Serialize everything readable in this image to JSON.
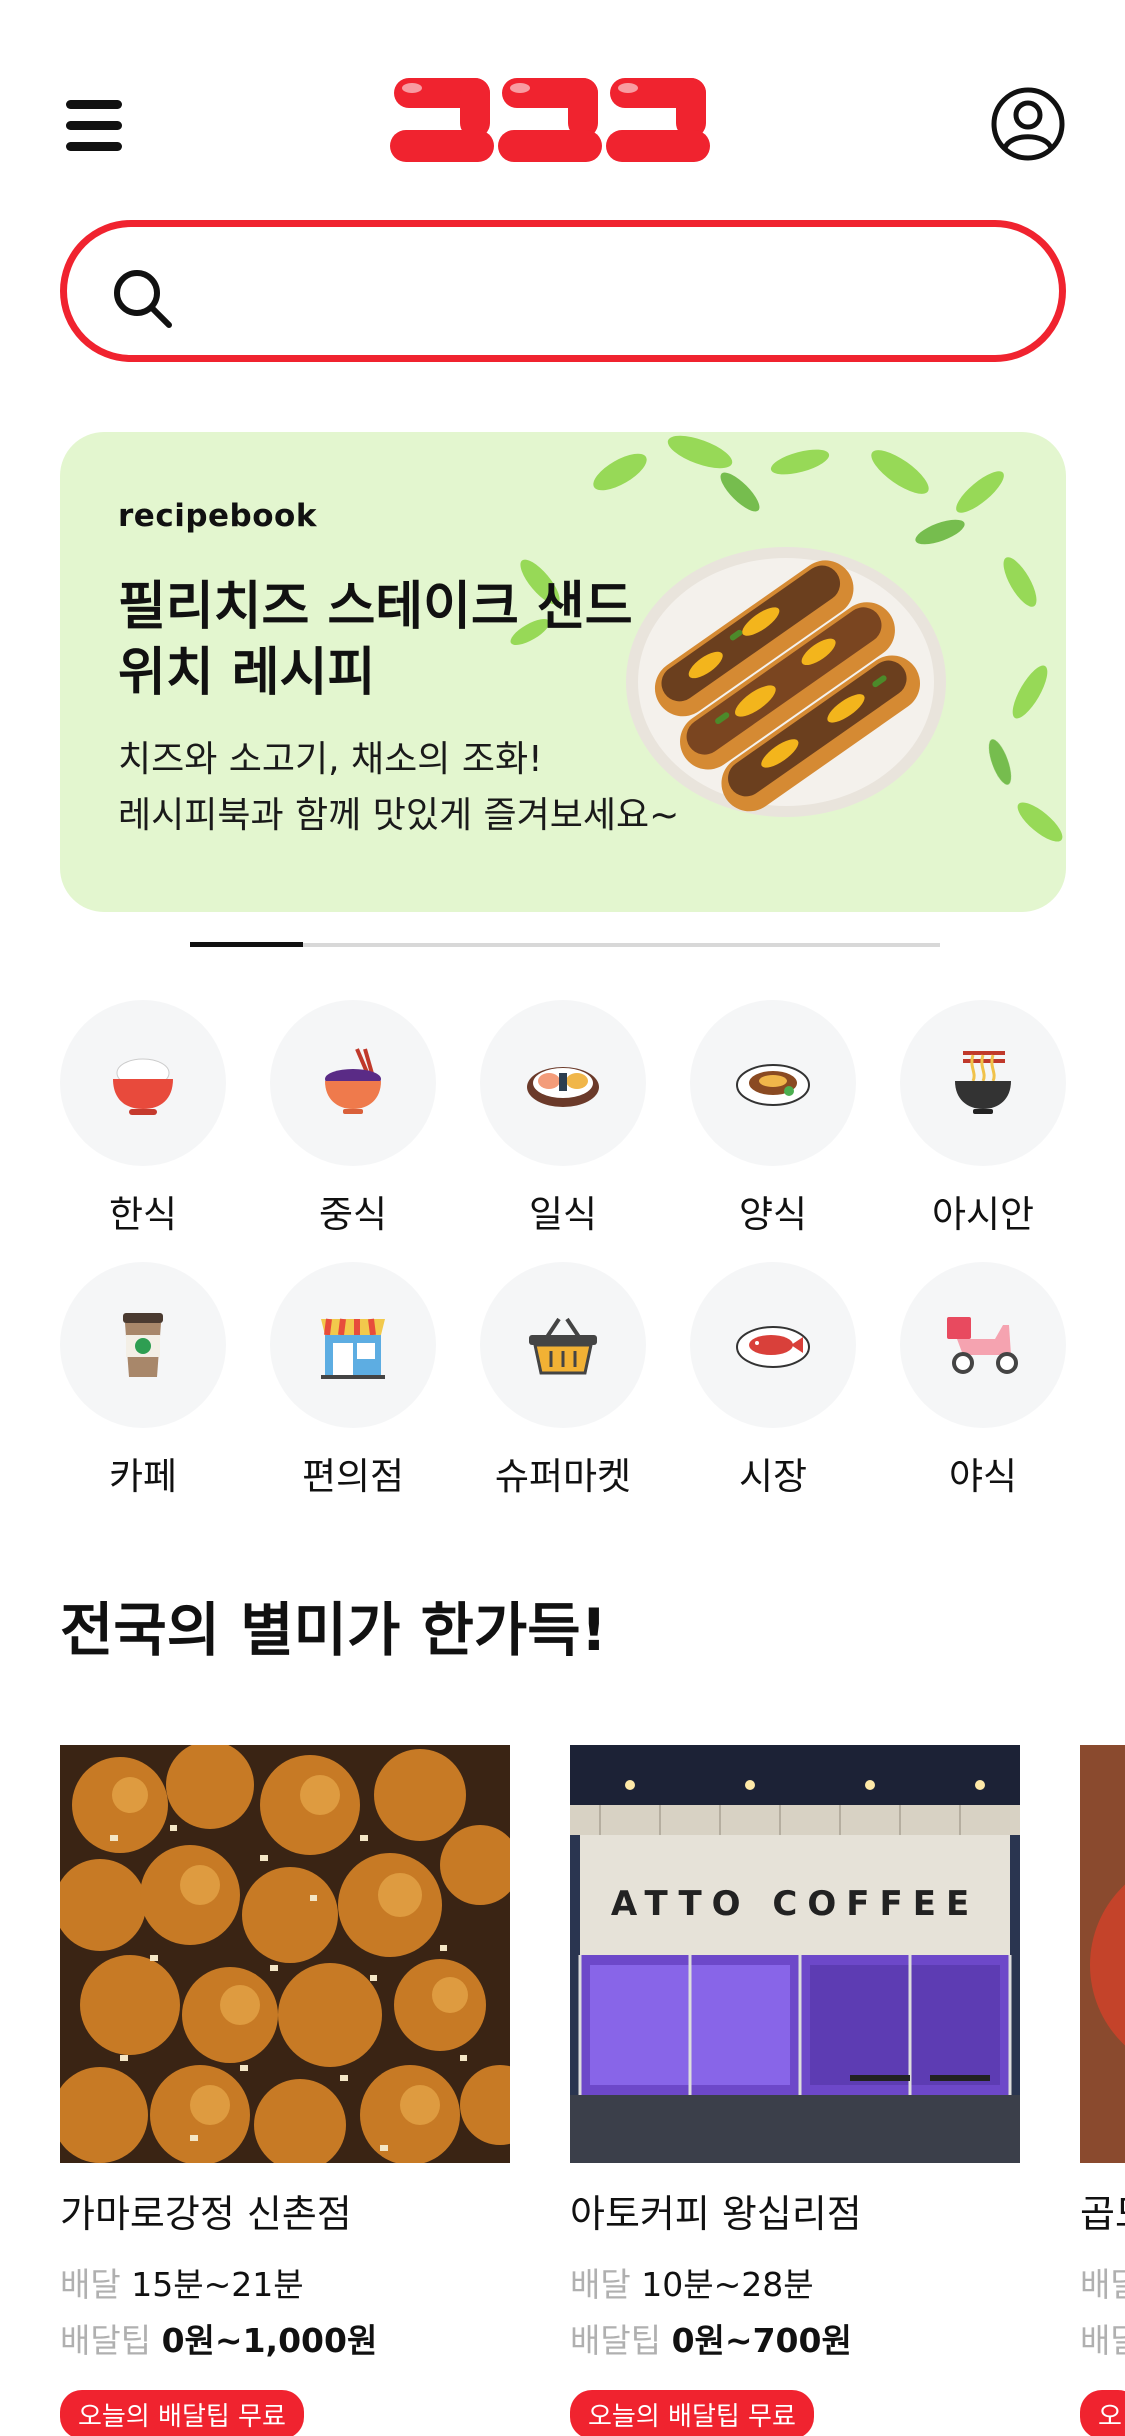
{
  "header": {
    "logo_text": "구구구",
    "menu_icon": "hamburger-menu-icon",
    "profile_icon": "user-circle-icon"
  },
  "search": {
    "placeholder": "",
    "value": "",
    "icon": "search-icon",
    "accent_color": "#f0232f"
  },
  "banner": {
    "brand": "recipebook",
    "title": "필리치즈 스테이크 샌드위치 레시피",
    "description_line1": "치즈와 소고기, 채소의 조화!",
    "description_line2": "레시피북과 함께 맛있게 즐겨보세요~",
    "background_color": "#e3f6cf",
    "slide_progress": 0.15
  },
  "categories": [
    {
      "label": "한식",
      "icon": "rice-bowl-icon"
    },
    {
      "label": "중식",
      "icon": "noodle-bowl-icon"
    },
    {
      "label": "일식",
      "icon": "sushi-icon"
    },
    {
      "label": "양식",
      "icon": "pasta-plate-icon"
    },
    {
      "label": "아시안",
      "icon": "ramen-bowl-icon"
    },
    {
      "label": "카페",
      "icon": "coffee-cup-icon"
    },
    {
      "label": "편의점",
      "icon": "convenience-store-icon"
    },
    {
      "label": "슈퍼마켓",
      "icon": "shopping-basket-icon"
    },
    {
      "label": "시장",
      "icon": "fish-plate-icon"
    },
    {
      "label": "야식",
      "icon": "delivery-scooter-icon"
    }
  ],
  "section": {
    "title": "전국의 별미가 한가득!"
  },
  "stores": [
    {
      "name": "가마로강정 신촌점",
      "delivery_label": "배달",
      "delivery_time": "15분~21분",
      "tip_label": "배달팁",
      "tip_value": "0원~1,000원",
      "badge": "오늘의 배달팁 무료"
    },
    {
      "name": "아토커피 왕십리점",
      "delivery_label": "배달",
      "delivery_time": "10분~28분",
      "tip_label": "배달팁",
      "tip_value": "0원~700원",
      "badge": "오늘의 배달팁 무료",
      "image_sign": "ATTO COFFEE"
    },
    {
      "name": "곱도",
      "delivery_label": "배달",
      "tip_label": "배달팁",
      "badge": "오"
    }
  ]
}
